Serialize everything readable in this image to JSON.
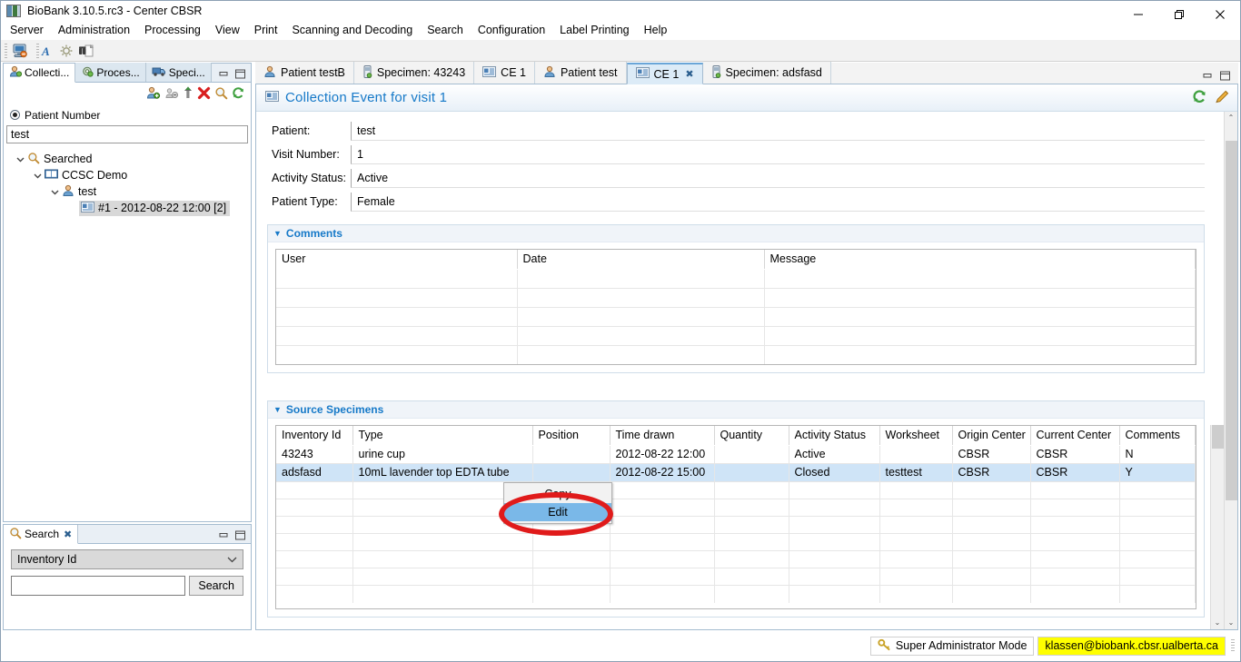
{
  "window": {
    "title": "BioBank 3.10.5.rc3 - Center CBSR",
    "minimize_label": "–",
    "maximize_label": "❐",
    "close_label": "✕"
  },
  "menubar": [
    {
      "label": "Server"
    },
    {
      "label": "Administration"
    },
    {
      "label": "Processing"
    },
    {
      "label": "View"
    },
    {
      "label": "Print"
    },
    {
      "label": "Scanning and Decoding"
    },
    {
      "label": "Search"
    },
    {
      "label": "Configuration"
    },
    {
      "label": "Label Printing"
    },
    {
      "label": "Help"
    }
  ],
  "toolbar": {
    "items": [
      {
        "icon": "server-connect-icon"
      },
      {
        "icon": "blue-letter-a-icon"
      },
      {
        "icon": "gear-icon"
      },
      {
        "icon": "binoculars-document-icon"
      }
    ]
  },
  "left_panel": {
    "tabs": [
      {
        "label": "Collecti...",
        "icon": "collection-person-icon",
        "active": true
      },
      {
        "label": "Proces...",
        "icon": "processing-gear-icon",
        "active": false
      },
      {
        "label": "Speci...",
        "icon": "specimen-truck-icon",
        "active": false
      }
    ],
    "toolbar_icons": [
      "add-patient-icon",
      "remove-patient-icon",
      "move-up-icon",
      "delete-icon",
      "search-icon",
      "refresh-icon"
    ],
    "radio_label": "Patient Number",
    "patient_number_value": "test",
    "tree": [
      {
        "label": "Searched",
        "icon": "search-icon",
        "depth": 0,
        "expanded": true,
        "selected": false
      },
      {
        "label": "CCSC Demo",
        "icon": "study-book-icon",
        "depth": 1,
        "expanded": true,
        "selected": false
      },
      {
        "label": "test",
        "icon": "patient-icon",
        "depth": 2,
        "expanded": true,
        "selected": false
      },
      {
        "label": "#1 - 2012-08-22 12:00 [2]",
        "icon": "collection-event-icon",
        "depth": 3,
        "expanded": false,
        "selected": true
      }
    ]
  },
  "search_panel": {
    "tab_label": "Search",
    "tab_icon": "search-icon",
    "close_label": "✖",
    "combo_value": "Inventory Id",
    "combo_arrow": "chevron-down-icon",
    "input_value": "",
    "input_placeholder": "",
    "button_label": "Search"
  },
  "editor": {
    "tabs": [
      {
        "label": "Patient testB",
        "icon": "patient-icon",
        "active": false,
        "closable": false
      },
      {
        "label": "Specimen: 43243",
        "icon": "specimen-icon",
        "active": false,
        "closable": false
      },
      {
        "label": "CE 1",
        "icon": "collection-event-icon",
        "active": false,
        "closable": false
      },
      {
        "label": "Patient test",
        "icon": "patient-icon",
        "active": false,
        "closable": false
      },
      {
        "label": "CE 1",
        "icon": "collection-event-icon",
        "active": true,
        "closable": true,
        "close_label": "✖"
      },
      {
        "label": "Specimen: adsfasd",
        "icon": "specimen-icon",
        "active": false,
        "closable": false
      }
    ],
    "form_title": "Collection Event for visit 1",
    "form_title_icon": "collection-event-icon",
    "header_actions": [
      {
        "icon": "refresh-icon"
      },
      {
        "icon": "edit-pencil-icon"
      }
    ],
    "fields": [
      {
        "label": "Patient:",
        "value": "test"
      },
      {
        "label": "Visit Number:",
        "value": "1"
      },
      {
        "label": "Activity Status:",
        "value": "Active"
      },
      {
        "label": "Patient Type:",
        "value": "Female"
      }
    ],
    "comments_section": {
      "title": "Comments",
      "arrow": "▼",
      "columns": [
        "User",
        "Date",
        "Message"
      ],
      "rows": [],
      "empty_row_count": 5
    },
    "source_specimens_section": {
      "title": "Source Specimens",
      "arrow": "▼",
      "columns": [
        "Inventory Id",
        "Type",
        "Position",
        "Time drawn",
        "Quantity",
        "Activity Status",
        "Worksheet",
        "Origin Center",
        "Current Center",
        "Comments"
      ],
      "rows": [
        {
          "selected": false,
          "cells": [
            "43243",
            "urine cup",
            "",
            "2012-08-22 12:00",
            "",
            "Active",
            "",
            "CBSR",
            "CBSR",
            "N"
          ]
        },
        {
          "selected": true,
          "cells": [
            "adsfasd",
            "10mL lavender top EDTA tube",
            "",
            "2012-08-22 15:00",
            "",
            "Closed",
            "testtest",
            "CBSR",
            "CBSR",
            "Y"
          ]
        }
      ],
      "empty_row_count": 8
    }
  },
  "context_menu": {
    "items": [
      {
        "label": "Copy",
        "highlighted": false
      },
      {
        "label": "Edit",
        "highlighted": true
      }
    ]
  },
  "annotation": {
    "shape": "red-ellipse",
    "color": "#e01b1b",
    "target": "Edit"
  },
  "statusbar": {
    "mode_label": "Super Administrator Mode",
    "mode_icon": "key-icon",
    "user_label": "klassen@biobank.cbsr.ualberta.ca",
    "user_highlight_color": "#ffff00"
  },
  "scrollbars": {
    "editor_vertical": {
      "up_arrow": "⌃",
      "down_arrow": "⌄"
    },
    "table_vertical": {
      "down_arrow": "⌄"
    }
  }
}
